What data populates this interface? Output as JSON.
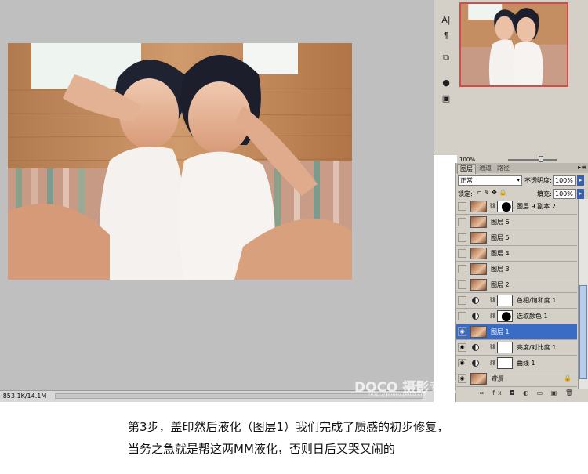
{
  "status_bar": {
    "doc_size": ":853.1K/14.1M"
  },
  "navigator": {
    "zoom": "100%"
  },
  "panel_tabs": [
    "图层",
    "通道",
    "路径"
  ],
  "blend": {
    "mode": "正常",
    "opacity_label": "不透明度:",
    "opacity_value": "100%"
  },
  "lock": {
    "label": "锁定:",
    "fill_label": "填充:",
    "fill_value": "100%"
  },
  "layers": [
    {
      "name": "图层 9 副本 2",
      "visible": false,
      "kind": "mask-black"
    },
    {
      "name": "图层 6",
      "visible": false,
      "kind": "pixel"
    },
    {
      "name": "图层 5",
      "visible": false,
      "kind": "pixel"
    },
    {
      "name": "图层 4",
      "visible": false,
      "kind": "pixel"
    },
    {
      "name": "图层 3",
      "visible": false,
      "kind": "pixel"
    },
    {
      "name": "图层 2",
      "visible": false,
      "kind": "pixel"
    },
    {
      "name": "色相/饱和度 1",
      "visible": false,
      "kind": "adjust"
    },
    {
      "name": "选取颜色 1",
      "visible": false,
      "kind": "adjust-black"
    },
    {
      "name": "图层 1",
      "visible": true,
      "kind": "pixel",
      "selected": true
    },
    {
      "name": "亮度/对比度 1",
      "visible": true,
      "kind": "adjust"
    },
    {
      "name": "曲线 1",
      "visible": true,
      "kind": "adjust"
    },
    {
      "name": "背景",
      "visible": true,
      "kind": "background"
    }
  ],
  "watermark": {
    "brand": "DOCO 摄影专题",
    "url": "http://photo.poco.cn/"
  },
  "caption": {
    "line1": "第3步，盖印然后液化（图层1）我们完成了质感的初步修复，",
    "line2": "当务之急就是帮这两MM液化，否则日后又哭又闹的"
  },
  "colors": {
    "selected_row": "#3a6cc6",
    "panel_bg": "#d4d0c8",
    "canvas_bg": "#bfbfbf"
  }
}
